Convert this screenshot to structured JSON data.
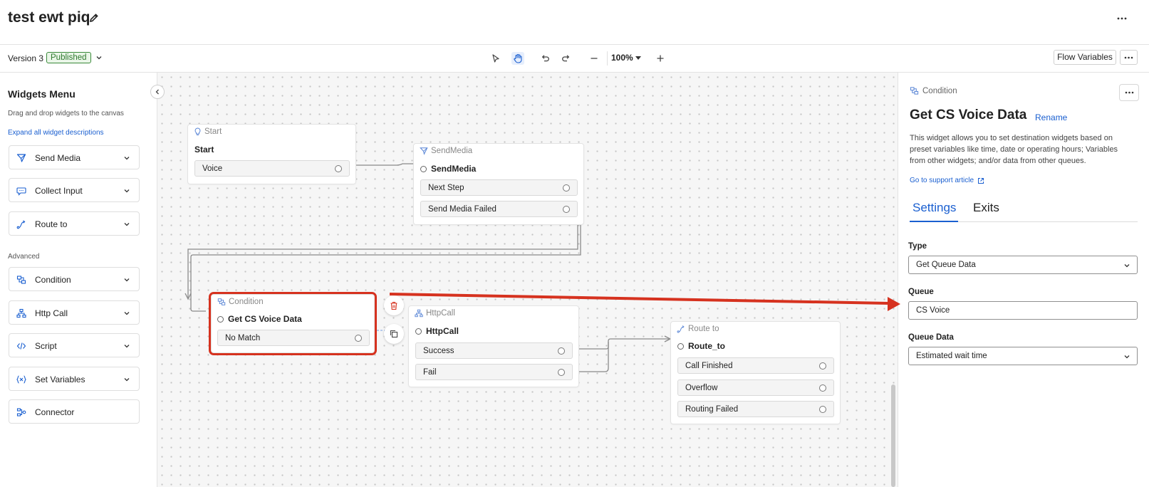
{
  "header": {
    "title": "test ewt piq"
  },
  "toolbar": {
    "version": "Version 3",
    "status": "Published",
    "zoom": "100%",
    "flow_variables": "Flow Variables"
  },
  "sidebar": {
    "title": "Widgets Menu",
    "subtitle": "Drag and drop widgets to the canvas",
    "expand_link": "Expand all widget descriptions",
    "advanced_label": "Advanced",
    "items": [
      {
        "label": "Send Media",
        "icon": "send-media-icon"
      },
      {
        "label": "Collect Input",
        "icon": "chat-icon"
      },
      {
        "label": "Route to",
        "icon": "route-icon"
      },
      {
        "label": "Condition",
        "icon": "condition-icon"
      },
      {
        "label": "Http Call",
        "icon": "http-icon"
      },
      {
        "label": "Script",
        "icon": "code-icon"
      },
      {
        "label": "Set Variables",
        "icon": "variables-icon"
      },
      {
        "label": "Connector",
        "icon": "connector-icon"
      }
    ]
  },
  "canvas": {
    "nodes": {
      "start": {
        "type": "Start",
        "name": "Start",
        "exits": [
          "Voice"
        ]
      },
      "sendmedia": {
        "type": "SendMedia",
        "name": "SendMedia",
        "exits": [
          "Next Step",
          "Send Media Failed"
        ]
      },
      "condition": {
        "type": "Condition",
        "name": "Get CS Voice Data",
        "exits": [
          "No Match"
        ]
      },
      "httpcall": {
        "type": "HttpCall",
        "name": "HttpCall",
        "exits": [
          "Success",
          "Fail"
        ]
      },
      "routeto": {
        "type": "Route to",
        "name": "Route_to",
        "exits": [
          "Call Finished",
          "Overflow",
          "Routing Failed"
        ]
      }
    }
  },
  "panel": {
    "kind": "Condition",
    "title": "Get CS Voice Data",
    "rename": "Rename",
    "description": "This widget allows you to set destination widgets based on preset variables like time, date or operating hours; Variables from other widgets; and/or data from other queues.",
    "support_link": "Go to support article",
    "tabs": [
      "Settings",
      "Exits"
    ],
    "fields": {
      "type": {
        "label": "Type",
        "value": "Get Queue Data"
      },
      "queue": {
        "label": "Queue",
        "value": "CS Voice"
      },
      "queue_data": {
        "label": "Queue Data",
        "value": "Estimated wait time"
      }
    }
  },
  "colors": {
    "accent": "#1a5fd0",
    "highlight": "#d6321f",
    "published": "#2f7a2f"
  }
}
